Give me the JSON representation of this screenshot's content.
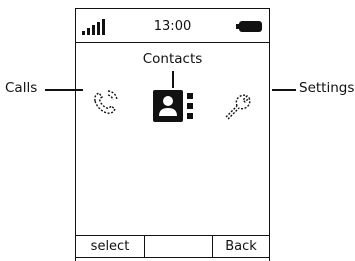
{
  "status_bar": {
    "time": "13:00",
    "signal_icon": "signal-strength-icon",
    "battery_icon": "battery-icon"
  },
  "menu": {
    "selected_title": "Contacts",
    "items": [
      {
        "label": "Calls",
        "icon": "phone-handset-icon"
      },
      {
        "label": "Contacts",
        "icon": "contacts-book-icon",
        "selected": true
      },
      {
        "label": "Settings",
        "icon": "wrench-screwdriver-icon"
      }
    ]
  },
  "softkeys": {
    "left": "select",
    "middle": "",
    "right": "Back"
  },
  "callouts": {
    "left": "Calls",
    "right": "Settings"
  }
}
